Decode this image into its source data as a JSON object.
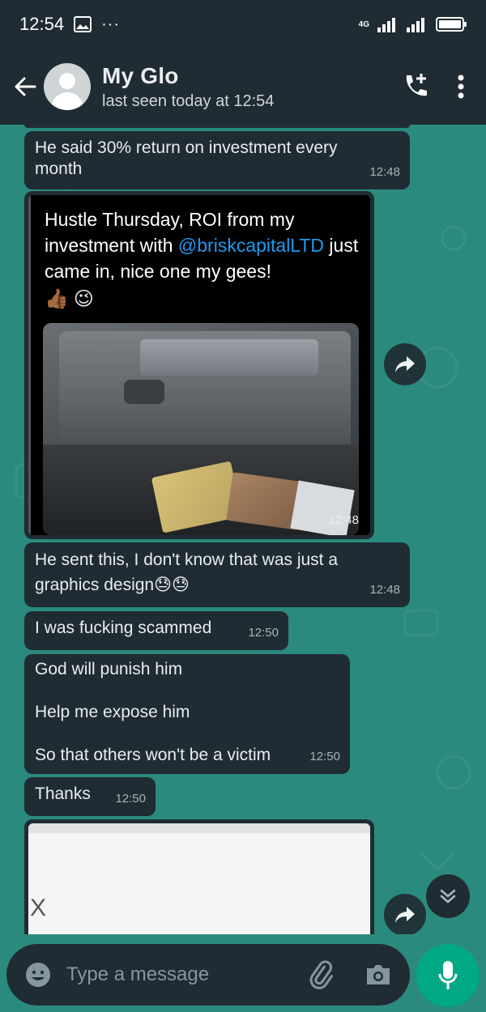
{
  "status_bar": {
    "time": "12:54",
    "network": "4G"
  },
  "header": {
    "contact_name": "My Glo",
    "last_seen": "last seen today at 12:54"
  },
  "messages": [
    {
      "text": "He said 30% return on investment every month",
      "time": "12:48"
    },
    {
      "type": "image",
      "tweet_text_before": "Hustle Thursday, ROI from my investment with ",
      "tweet_handle": "@briskcapitalLTD",
      "tweet_text_after": " just came in, nice one my gees!",
      "emojis": [
        "👍🏾",
        "😉"
      ],
      "time": "12:48"
    },
    {
      "text": "He sent this, I don't know that was just a graphics design😓😓",
      "time": "12:48"
    },
    {
      "text": "I was fucking scammed",
      "time": "12:50"
    },
    {
      "lines": [
        "God will punish him",
        "Help me expose him",
        "So that others won't be a victim"
      ],
      "time": "12:50"
    },
    {
      "text": "Thanks",
      "time": "12:50"
    }
  ],
  "partial_image_glyph": "X",
  "input": {
    "placeholder": "Type a message"
  },
  "colors": {
    "header_bg": "#1f2c33",
    "chat_bg": "#2b8a7e",
    "bubble_bg": "#1f2c33",
    "accent": "#00a884",
    "link": "#1d9bf0"
  }
}
